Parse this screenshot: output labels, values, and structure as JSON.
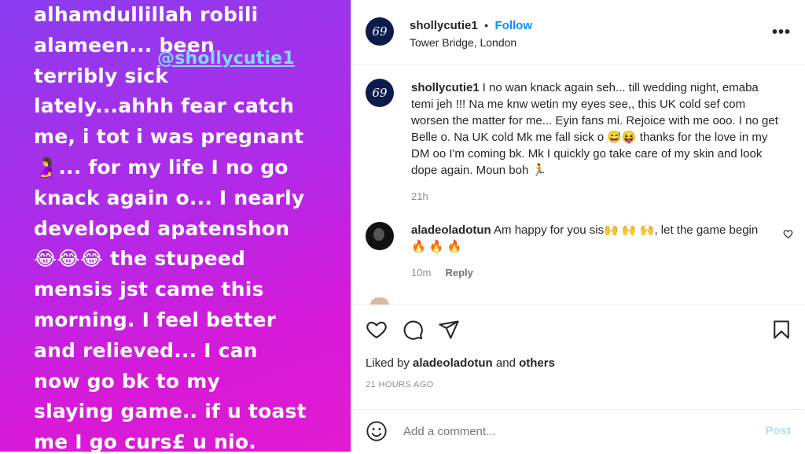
{
  "story": {
    "text": "alhamdullillah robili\nalameen... been\nterribly sick\nlately...ahhh fear catch\nme, i tot i was pregnant\n🤰... for my life I no go\nknack again o... I nearly\ndeveloped apatenshon\n😂😂😂 the stupeed\nmensis jst came this\nmorning. I feel better\nand relieved... I can\nnow go bk to my\nslaying game.. if u toast\nme I go curs£ u nio.",
    "mention": "@shollycutie1"
  },
  "header": {
    "avatar_text": "69",
    "username": "shollycutie1",
    "separator": "•",
    "follow_label": "Follow",
    "location": "Tower Bridge, London",
    "more_label": "•••"
  },
  "caption": {
    "avatar_text": "69",
    "username": "shollycutie1",
    "text": "I no wan knack again seh... till wedding night, emaba temi jeh !!! Na me knw wetin my eyes see,, this UK cold sef com worsen the matter for me... Eyin fans mi. Rejoice with me ooo. I no get Belle o. Na UK cold Mk me fall sick o 😅😝 thanks for the love in my DM oo I'm coming bk. Mk I quickly go take care of my skin and look dope again. Moun boh 🏃",
    "time": "21h"
  },
  "comment": {
    "username": "aladeoladotun",
    "text": "Am happy for you sis🙌 🙌 🙌, let the game begin 🔥 🔥 🔥",
    "time": "10m",
    "reply_label": "Reply"
  },
  "actions": {
    "liked_prefix": "Liked by",
    "liked_user": "aladeoladotun",
    "liked_and": "and",
    "liked_others": "others",
    "time_ago": "21 HOURS AGO"
  },
  "add_comment": {
    "placeholder": "Add a comment...",
    "post_label": "Post"
  },
  "colors": {
    "accent": "#0095f6",
    "avatar_bg": "#0d1b4c",
    "story_gradient_start": "#8a3df0",
    "story_gradient_end": "#e11bd0"
  }
}
